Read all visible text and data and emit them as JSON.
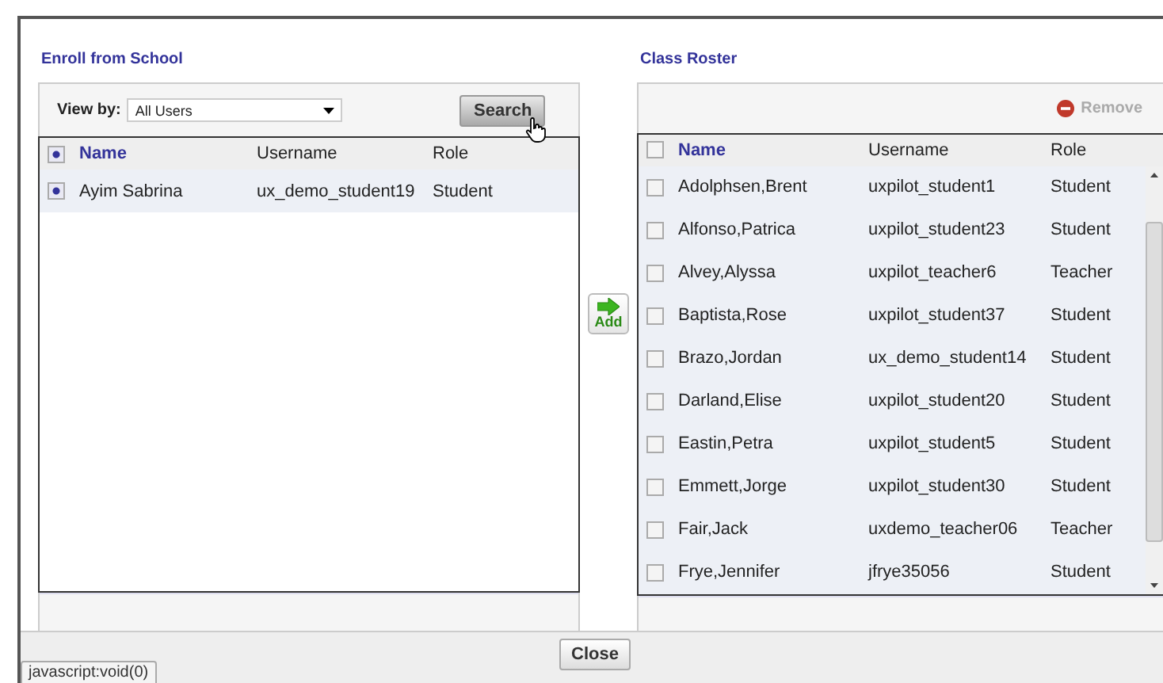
{
  "left_panel": {
    "title": "Enroll from School",
    "view_label": "View by:",
    "view_value": "All Users",
    "search_button": "Search",
    "columns": [
      "Name",
      "Username",
      "Role"
    ],
    "header_checked": true,
    "rows": [
      {
        "name": "Ayim Sabrina",
        "username": "ux_demo_student19",
        "role": "Student",
        "checked": true
      }
    ]
  },
  "add_button": "Add",
  "right_panel": {
    "title": "Class Roster",
    "remove_button": {
      "label": "Remove",
      "disabled": true
    },
    "columns": [
      "Name",
      "Username",
      "Role"
    ],
    "header_checked": false,
    "rows": [
      {
        "name": "Adolphsen,Brent",
        "username": "uxpilot_student1",
        "role": "Student",
        "checked": false
      },
      {
        "name": "Alfonso,Patrica",
        "username": "uxpilot_student23",
        "role": "Student",
        "checked": false
      },
      {
        "name": "Alvey,Alyssa",
        "username": "uxpilot_teacher6",
        "role": "Teacher",
        "checked": false
      },
      {
        "name": "Baptista,Rose",
        "username": "uxpilot_student37",
        "role": "Student",
        "checked": false
      },
      {
        "name": "Brazo,Jordan",
        "username": "ux_demo_student14",
        "role": "Student",
        "checked": false
      },
      {
        "name": "Darland,Elise",
        "username": "uxpilot_student20",
        "role": "Student",
        "checked": false
      },
      {
        "name": "Eastin,Petra",
        "username": "uxpilot_student5",
        "role": "Student",
        "checked": false
      },
      {
        "name": "Emmett,Jorge",
        "username": "uxpilot_student30",
        "role": "Student",
        "checked": false
      },
      {
        "name": "Fair,Jack",
        "username": "uxdemo_teacher06",
        "role": "Teacher",
        "checked": false
      },
      {
        "name": "Frye,Jennifer",
        "username": "jfrye35056",
        "role": "Student",
        "checked": false
      }
    ]
  },
  "close_button": "Close",
  "status_text": "javascript:void(0)"
}
